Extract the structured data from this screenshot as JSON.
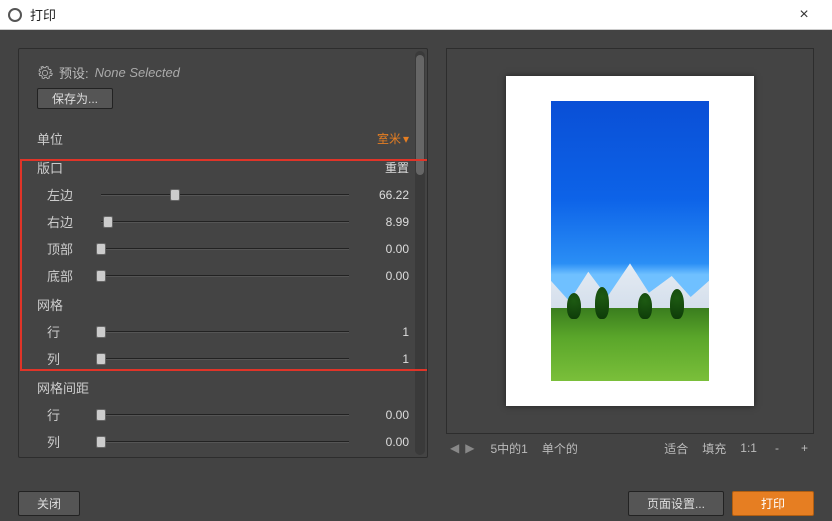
{
  "window": {
    "title": "打印"
  },
  "preset": {
    "label": "预设:",
    "value": "None Selected",
    "save": "保存为..."
  },
  "unit": {
    "label": "单位",
    "value": "室米"
  },
  "viewport": {
    "label": "版口",
    "reset": "重置",
    "left": {
      "label": "左边",
      "value": "66.22",
      "pos": 30
    },
    "right": {
      "label": "右边",
      "value": "8.99",
      "pos": 3
    },
    "top": {
      "label": "顶部",
      "value": "0.00",
      "pos": 0
    },
    "bottom": {
      "label": "底部",
      "value": "0.00",
      "pos": 0
    }
  },
  "grid": {
    "label": "网格",
    "rows": {
      "label": "行",
      "value": "1",
      "pos": 0
    },
    "cols": {
      "label": "列",
      "value": "1",
      "pos": 0
    }
  },
  "spacing": {
    "label": "网格间距",
    "rows": {
      "label": "行",
      "value": "0.00",
      "pos": 0
    },
    "cols": {
      "label": "列",
      "value": "0.00",
      "pos": 0
    }
  },
  "status": {
    "page": "5中的1",
    "mode": "单个的",
    "fit": "适合",
    "fill": "填充",
    "scale": "1:1",
    "minus": "-",
    "plus": "+"
  },
  "footer": {
    "close": "关闭",
    "pageSetup": "页面设置...",
    "print": "打印"
  }
}
